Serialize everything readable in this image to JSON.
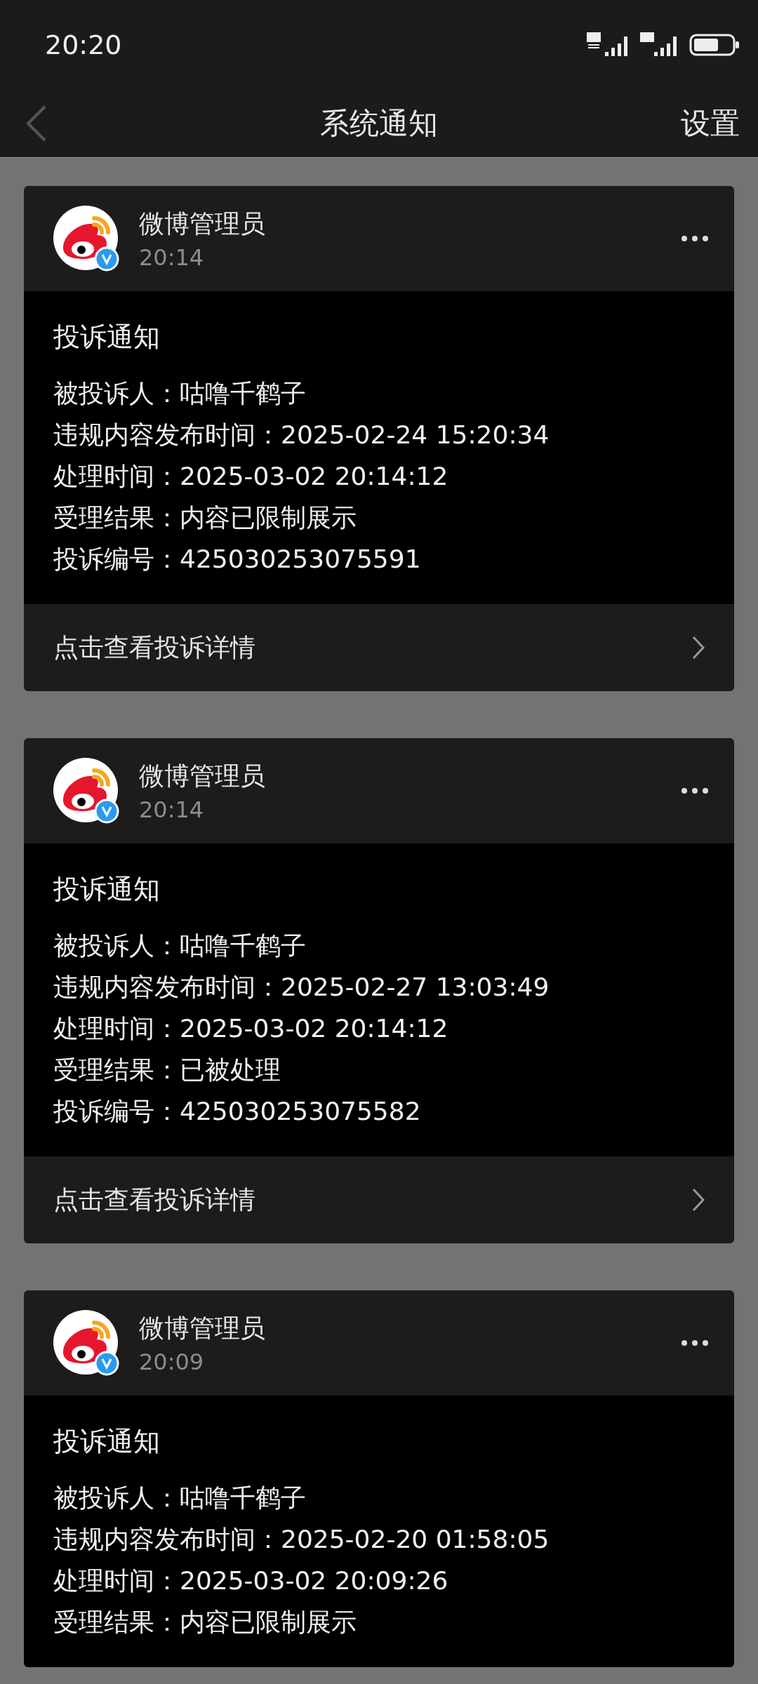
{
  "status_bar": {
    "time": "20:20"
  },
  "nav": {
    "title": "系统通知",
    "action": "设置"
  },
  "notifications": [
    {
      "sender": "微博管理员",
      "time": "20:14",
      "title": "投诉通知",
      "fields": [
        {
          "label": "被投诉人：",
          "value": "咕噜千鹤子"
        },
        {
          "label": "违规内容发布时间：",
          "value": "2025-02-24 15:20:34"
        },
        {
          "label": "处理时间：",
          "value": "2025-03-02 20:14:12"
        },
        {
          "label": "受理结果：",
          "value": "内容已限制展示"
        },
        {
          "label": "投诉编号：",
          "value": "425030253075591"
        }
      ],
      "link": "点击查看投诉详情"
    },
    {
      "sender": "微博管理员",
      "time": "20:14",
      "title": "投诉通知",
      "fields": [
        {
          "label": "被投诉人：",
          "value": "咕噜千鹤子"
        },
        {
          "label": "违规内容发布时间：",
          "value": "2025-02-27 13:03:49"
        },
        {
          "label": "处理时间：",
          "value": "2025-03-02 20:14:12"
        },
        {
          "label": "受理结果：",
          "value": "已被处理"
        },
        {
          "label": "投诉编号：",
          "value": "425030253075582"
        }
      ],
      "link": "点击查看投诉详情"
    },
    {
      "sender": "微博管理员",
      "time": "20:09",
      "title": "投诉通知",
      "fields": [
        {
          "label": "被投诉人：",
          "value": "咕噜千鹤子"
        },
        {
          "label": "违规内容发布时间：",
          "value": "2025-02-20 01:58:05"
        },
        {
          "label": "处理时间：",
          "value": "2025-03-02 20:09:26"
        },
        {
          "label": "受理结果：",
          "value": "内容已限制展示"
        }
      ]
    }
  ]
}
